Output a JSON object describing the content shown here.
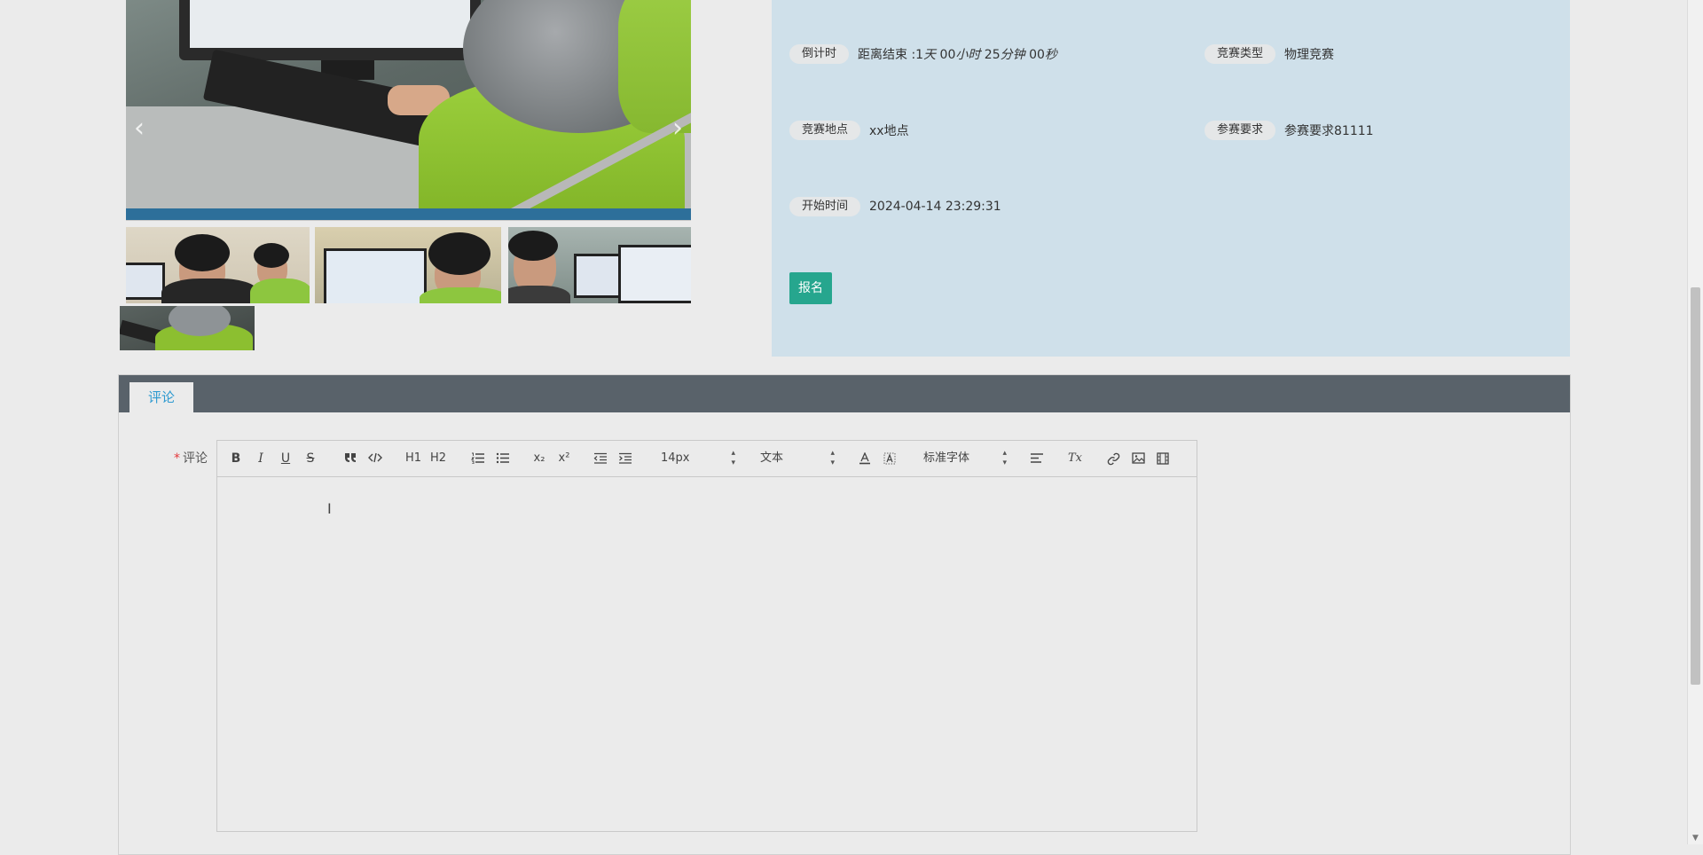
{
  "gallery": {
    "prev_glyph": "‹",
    "next_glyph": "›"
  },
  "info": {
    "countdown": {
      "label": "倒计时",
      "value_prefix": "距离结束 :1",
      "day": "天",
      "hours": " 00",
      "hour_unit": "小时",
      "minutes": " 25",
      "minute_unit": "分钟",
      "seconds": " 00",
      "second_unit": "秒"
    },
    "type": {
      "label": "竞赛类型",
      "value": "物理竞赛"
    },
    "location": {
      "label": "竞赛地点",
      "value": "xx地点"
    },
    "requirement": {
      "label": "参赛要求",
      "value": "参赛要求81111"
    },
    "start_time": {
      "label": "开始时间",
      "value": "2024-04-14 23:29:31"
    },
    "signup_label": "报名"
  },
  "comments": {
    "tab_label": "评论",
    "field_required_mark": "*",
    "field_label": "评论",
    "toolbar": {
      "bold": "B",
      "italic": "I",
      "underline": "U",
      "strike": "S",
      "h1": "H1",
      "h2": "H2",
      "sub": "x₂",
      "sup": "x²",
      "size": "14px",
      "header": "文本",
      "font": "标准字体",
      "clean": "Tx"
    },
    "cursor_glyph": "I"
  },
  "colors": {
    "panel_bg": "#cfe0ea",
    "signup_bg": "#26a68e",
    "tabbar_bg": "#59626a",
    "tab_text": "#2e9ad0"
  }
}
